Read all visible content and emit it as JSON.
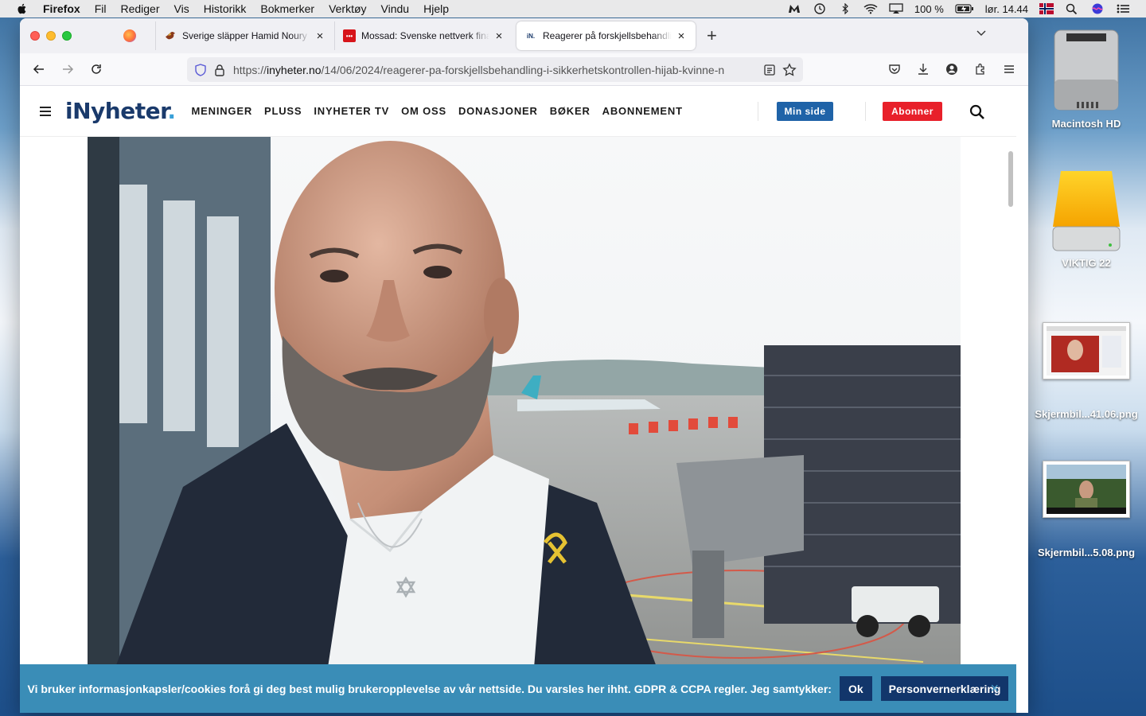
{
  "menubar": {
    "app": "Firefox",
    "items": [
      "Fil",
      "Rediger",
      "Vis",
      "Historikk",
      "Bokmerker",
      "Verktøy",
      "Vindu",
      "Hjelp"
    ],
    "battery": "100 %",
    "clock": "lør. 14.44"
  },
  "tabs": [
    {
      "title": "Sverige släpper Hamid Noury i utbyte",
      "favicon": "bird-icon"
    },
    {
      "title": "Mossad: Svenske nettverk finansiert",
      "favicon": "news-icon"
    },
    {
      "title": "Reagerer på forskjellsbehandling i",
      "favicon": "inyheter-icon",
      "active": true
    }
  ],
  "urlbar": {
    "prefix": "https://",
    "host": "inyheter.no",
    "path": "/14/06/2024/reagerer-pa-forskjellsbehandling-i-sikkerhetskontrollen-hijab-kvinne-n"
  },
  "site": {
    "logo": "iNyheter",
    "logo_dot": ".",
    "nav": [
      "MENINGER",
      "PLUSS",
      "INYHETER TV",
      "OM OSS",
      "DONASJONER",
      "BØKER",
      "ABONNEMENT"
    ],
    "min_side": "Min side",
    "abonner": "Abonner",
    "brand_colors": {
      "navy": "#1a3a6b",
      "accent": "#39a0d8",
      "red": "#e8202a",
      "button_blue": "#1f63a8"
    }
  },
  "cookie": {
    "text": "Vi bruker informasjonkapsler/cookies forå gi deg best mulig brukeropplevelse av vår nettside. Du varsles her ihht. GDPR & CCPA regler. Jeg samtykker:",
    "ok": "Ok",
    "privacy": "Personvernerklæring",
    "close": "×"
  },
  "desktop": [
    {
      "label": "Macintosh HD",
      "icon": "hard-drive-icon"
    },
    {
      "label": "VIKTIG 22",
      "icon": "external-drive-icon"
    },
    {
      "label": "Skjermbil...41.06.png",
      "icon": "screenshot-thumbnail"
    },
    {
      "label": "Skjermbil...5.08.png",
      "icon": "screenshot-thumbnail"
    }
  ]
}
